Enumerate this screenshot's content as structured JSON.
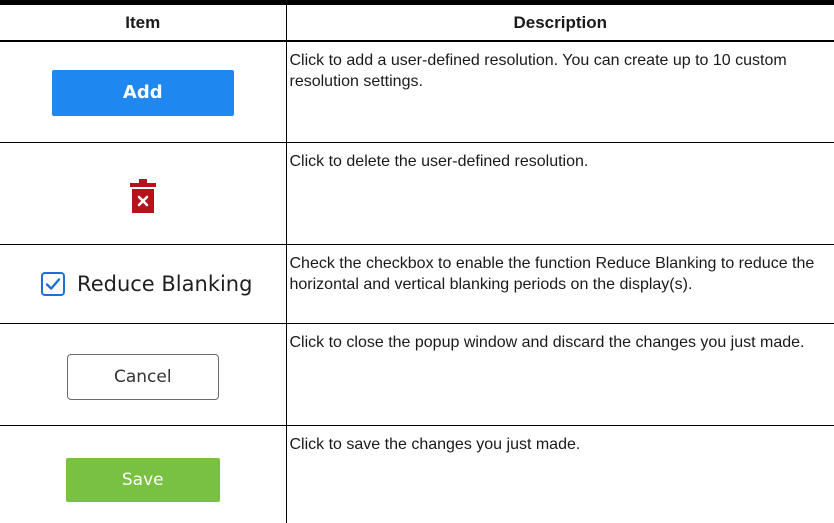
{
  "table": {
    "headers": {
      "item": "Item",
      "description": "Description"
    },
    "rows": [
      {
        "control_label": "Add",
        "description": "Click to add a user-defined resolution. You can create up to 10 custom resolution settings."
      },
      {
        "control_icon": "trash-delete-icon",
        "description": "Click to delete the user-defined resolution."
      },
      {
        "control_label": "Reduce Blanking",
        "checked": true,
        "description": "Check the checkbox to enable the function Reduce Blanking to reduce the horizontal and vertical blanking periods on the display(s)."
      },
      {
        "control_label": "Cancel",
        "description": "Click to close the popup window and discard the changes you just made."
      },
      {
        "control_label": "Save",
        "description": "Click to save the changes you just made."
      }
    ]
  },
  "colors": {
    "add_button": "#1e88f0",
    "delete_icon": "#b5121b",
    "checkbox_accent": "#1e6fd6",
    "save_button": "#79c142"
  }
}
